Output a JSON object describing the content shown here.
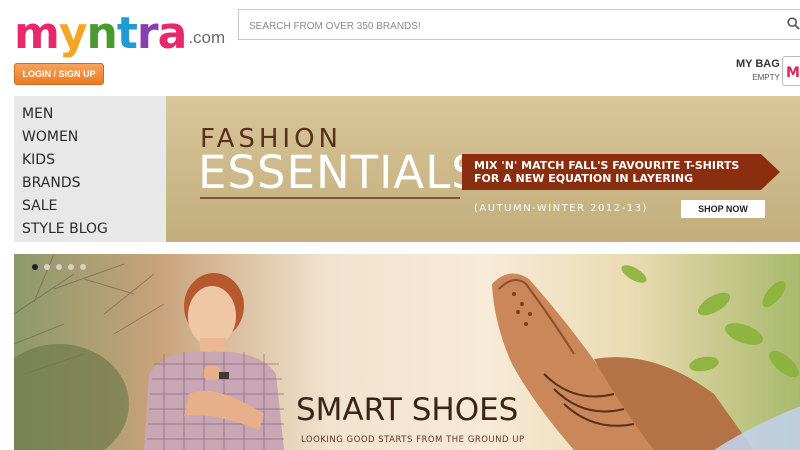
{
  "header": {
    "logo": {
      "letters": [
        "m",
        "y",
        "n",
        "t",
        "r",
        "a"
      ],
      "letter_colors": [
        "#e8286b",
        "#f6a623",
        "#4a9b2f",
        "#1f9ad6",
        "#8a3fb0",
        "#e8286b"
      ],
      "suffix": ".com"
    },
    "search": {
      "placeholder": "SEARCH FROM OVER 350 BRANDS!",
      "icon": "search-icon"
    },
    "login_label": "LOGIN / SIGN UP",
    "bag": {
      "title": "MY BAG",
      "status": "EMPTY",
      "icon_letter": "M"
    }
  },
  "nav": {
    "items": [
      "MEN",
      "WOMEN",
      "KIDS",
      "BRANDS",
      "SALE",
      "STYLE BLOG"
    ]
  },
  "promo": {
    "line1": "FASHION",
    "line2": "ESSENTIALS",
    "ribbon_line1": "MIX 'N' MATCH FALL'S  FAVOURITE T-SHIRTS",
    "ribbon_line2": "FOR A NEW EQUATION IN LAYERING",
    "season": "(AUTUMN-WINTER 2012-13)",
    "cta": "SHOP NOW"
  },
  "hero": {
    "title": "SMART SHOES",
    "tagline": "LOOKING GOOD STARTS FROM THE GROUND UP",
    "slide_count": 5,
    "active_slide": 1
  },
  "colors": {
    "accent_orange": "#ec7a25",
    "ribbon": "#8b2e10",
    "banner_bg": "#cdb98a"
  }
}
